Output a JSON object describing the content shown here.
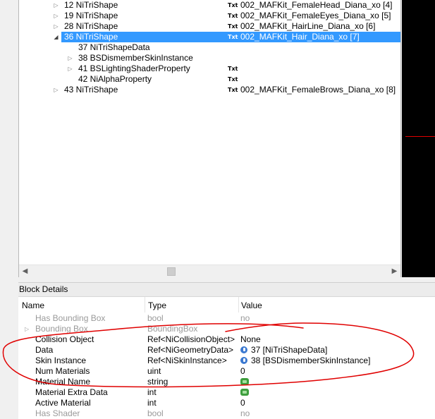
{
  "tree": {
    "rows": [
      {
        "name": "12 NiTriShape",
        "txt": "Txt",
        "value": "002_MAFKit_FemaleHead_Diana_xo [4]"
      },
      {
        "name": "19 NiTriShape",
        "txt": "Txt",
        "value": "002_MAFKit_FemaleEyes_Diana_xo [5]"
      },
      {
        "name": "28 NiTriShape",
        "txt": "Txt",
        "value": "002_MAFKit_HairLine_Diana_xo [6]"
      },
      {
        "name": "36 NiTriShape",
        "txt": "Txt",
        "value": "002_MAFKit_Hair_Diana_xo [7]"
      },
      {
        "name": "37 NiTriShapeData",
        "txt": "",
        "value": ""
      },
      {
        "name": "38 BSDismemberSkinInstance",
        "txt": "",
        "value": ""
      },
      {
        "name": "41 BSLightingShaderProperty",
        "txt": "Txt",
        "value": ""
      },
      {
        "name": "42 NiAlphaProperty",
        "txt": "Txt",
        "value": ""
      },
      {
        "name": "43 NiTriShape",
        "txt": "Txt",
        "value": "002_MAFKit_FemaleBrows_Diana_xo [8]"
      }
    ]
  },
  "block_details": {
    "title": "Block Details",
    "columns": {
      "name": "Name",
      "type": "Type",
      "value": "Value"
    },
    "rows": [
      {
        "name": "Has Bounding Box",
        "type": "bool",
        "value": "no"
      },
      {
        "name": "Bounding Box",
        "type": "BoundingBox",
        "value": ""
      },
      {
        "name": "Collision Object",
        "type": "Ref<NiCollisionObject>",
        "value": "None"
      },
      {
        "name": "Data",
        "type": "Ref<NiGeometryData>",
        "value": "37 [NiTriShapeData]"
      },
      {
        "name": "Skin Instance",
        "type": "Ref<NiSkinInstance>",
        "value": "38 [BSDismemberSkinInstance]"
      },
      {
        "name": "Num Materials",
        "type": "uint",
        "value": "0"
      },
      {
        "name": "Material Name",
        "type": "string",
        "value": ""
      },
      {
        "name": "Material Extra Data",
        "type": "int",
        "value": ""
      },
      {
        "name": "Active Material",
        "type": "int",
        "value": "0"
      },
      {
        "name": "Has Shader",
        "type": "bool",
        "value": "no"
      }
    ]
  },
  "colors": {
    "selection": "#3399ff",
    "annotation": "#e00000"
  }
}
